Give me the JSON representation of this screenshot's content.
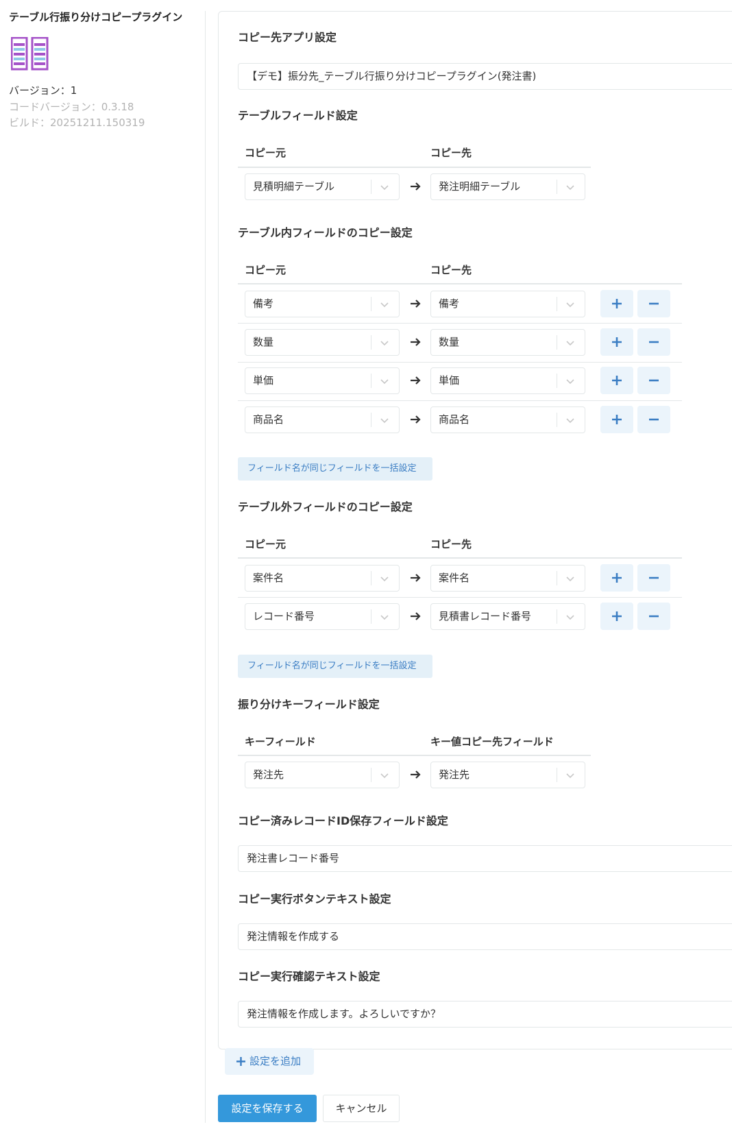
{
  "sidebar": {
    "title": "テーブル行振り分けコピープラグイン",
    "version": "バージョン：1",
    "code_version": "コードバージョン：0.3.18",
    "build": "ビルド：20251211.150319",
    "icon": "plugin-columns-icon"
  },
  "dest_app": {
    "title": "コピー先アプリ設定",
    "value": "【デモ】振分先_テーブル行振り分けコピープラグイン(発注書)"
  },
  "table_field": {
    "title": "テーブルフィールド設定",
    "col_src": "コピー元",
    "col_dst": "コピー先",
    "rows": [
      {
        "src": "見積明細テーブル",
        "dst": "発注明細テーブル"
      }
    ]
  },
  "in_table": {
    "title": "テーブル内フィールドのコピー設定",
    "col_src": "コピー元",
    "col_dst": "コピー先",
    "rows": [
      {
        "src": "備考",
        "dst": "備考"
      },
      {
        "src": "数量",
        "dst": "数量"
      },
      {
        "src": "単価",
        "dst": "単価"
      },
      {
        "src": "商品名",
        "dst": "商品名"
      }
    ],
    "bulk_button": "フィールド名が同じフィールドを一括設定"
  },
  "out_table": {
    "title": "テーブル外フィールドのコピー設定",
    "col_src": "コピー元",
    "col_dst": "コピー先",
    "rows": [
      {
        "src": "案件名",
        "dst": "案件名"
      },
      {
        "src": "レコード番号",
        "dst": "見積書レコード番号"
      }
    ],
    "bulk_button": "フィールド名が同じフィールドを一括設定"
  },
  "key_field": {
    "title": "振り分けキーフィールド設定",
    "col_src": "キーフィールド",
    "col_dst": "キー値コピー先フィールド",
    "rows": [
      {
        "src": "発注先",
        "dst": "発注先"
      }
    ]
  },
  "copied_id": {
    "title": "コピー済みレコードID保存フィールド設定",
    "value": "発注書レコード番号"
  },
  "button_text": {
    "title": "コピー実行ボタンテキスト設定",
    "value": "発注情報を作成する"
  },
  "confirm_text": {
    "title": "コピー実行確認テキスト設定",
    "value": "発注情報を作成します。よろしいですか？"
  },
  "actions": {
    "add_setting": "設定を追加",
    "save": "設定を保存する",
    "cancel": "キャンセル"
  },
  "colors": {
    "accent": "#3498db",
    "link": "#3a7dc3",
    "button_bg": "#ebf4fb",
    "icon_purple": "#a552c8",
    "icon_stripe": "#8ec8e8"
  }
}
